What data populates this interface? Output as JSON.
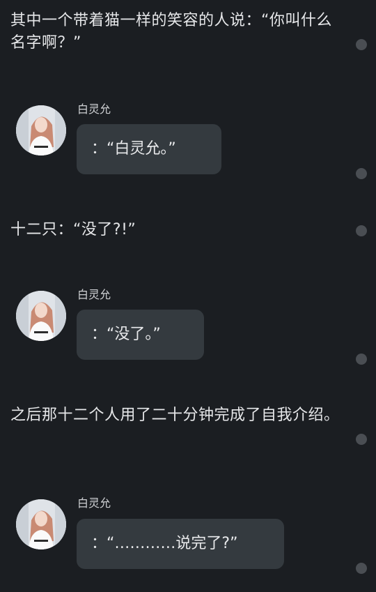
{
  "messages": {
    "narration1": "其中一个带着猫一样的笑容的人说：“你叫什么名字啊？”",
    "speaker1": "白灵允",
    "bubble1": "：“白灵允。”",
    "narration2": "十二只：“没了?!”",
    "speaker2": "白灵允",
    "bubble2": "：“没了。”",
    "narration3": "之后那十二个人用了二十分钟完成了自我介绍。",
    "speaker3": "白灵允",
    "bubble3": "：“…………说完了?”"
  },
  "colors": {
    "background": "#1b1e22",
    "bubble": "#343a3f",
    "dot": "#4a4e53",
    "text": "#e9eaec"
  },
  "icons": {
    "avatar": "avatar-photo",
    "dot": "menu-dot-icon"
  }
}
